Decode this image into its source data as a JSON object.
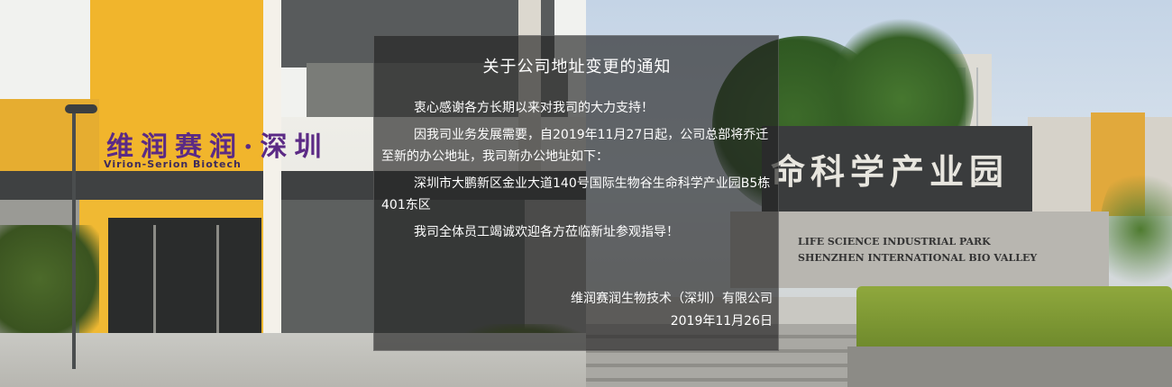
{
  "notice": {
    "title": "关于公司地址变更的通知",
    "paragraphs": [
      "衷心感谢各方长期以来对我司的大力支持！",
      "因我司业务发展需要，自2019年11月27日起，公司总部将乔迁至新的办公地址，我司新办公地址如下：",
      "深圳市大鹏新区金业大道140号国际生物谷生命科学产业园B5栋401东区",
      "我司全体员工竭诚欢迎各方莅临新址参观指导！"
    ],
    "company": "维润赛润生物技术（深圳）有限公司",
    "date": "2019年11月26日"
  },
  "photos": {
    "left_sign_cn": "维润赛润·深圳",
    "left_sign_en": "Virion-Serion Biotech",
    "right_sign_cn": "命科学产业园",
    "right_sign_en_1": "LIFE SCIENCE INDUSTRIAL PARK",
    "right_sign_en_2": "SHENZHEN INTERNATIONAL BIO VALLEY"
  }
}
